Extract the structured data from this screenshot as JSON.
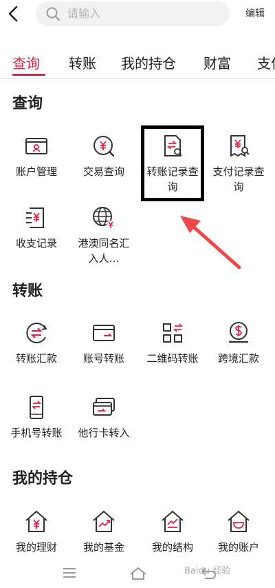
{
  "header": {
    "search_placeholder": "请输入",
    "edit_label": "编辑"
  },
  "tabs": [
    {
      "label": "查询",
      "active": true
    },
    {
      "label": "转账",
      "active": false
    },
    {
      "label": "我的持仓",
      "active": false
    },
    {
      "label": "财富",
      "active": false
    },
    {
      "label": "支付",
      "active": false
    }
  ],
  "sections": {
    "query": {
      "title": "查询",
      "items": [
        {
          "label": "账户管理",
          "icon": "account-card-icon"
        },
        {
          "label": "交易查询",
          "icon": "yen-search-icon"
        },
        {
          "label": "转账记录查询",
          "icon": "transfer-doc-search-icon"
        },
        {
          "label": "支付记录查询",
          "icon": "yen-receipt-search-icon"
        },
        {
          "label": "收支记录",
          "icon": "income-expense-icon"
        },
        {
          "label": "港澳同名汇入人…",
          "icon": "globe-yen-icon"
        }
      ]
    },
    "transfer": {
      "title": "转账",
      "items": [
        {
          "label": "转账汇款",
          "icon": "transfer-circle-icon"
        },
        {
          "label": "账号转账",
          "icon": "card-transfer-icon"
        },
        {
          "label": "二维码转账",
          "icon": "qr-transfer-icon"
        },
        {
          "label": "跨境汇款",
          "icon": "cross-border-dollar-icon"
        },
        {
          "label": "手机号转账",
          "icon": "phone-transfer-icon"
        },
        {
          "label": "他行卡转入",
          "icon": "other-bank-card-icon"
        }
      ]
    },
    "holdings": {
      "title": "我的持仓",
      "items": [
        {
          "label": "我的理财",
          "icon": "house-yen-icon"
        },
        {
          "label": "我的基金",
          "icon": "house-chart-icon"
        },
        {
          "label": "我的结构",
          "icon": "house-structure-icon"
        },
        {
          "label": "我的账户",
          "icon": "house-bowl-icon"
        }
      ]
    }
  },
  "watermark": "Baidu 经验",
  "colors": {
    "accent": "#e51f3f",
    "text": "#222222",
    "highlight_box": "#000000"
  }
}
